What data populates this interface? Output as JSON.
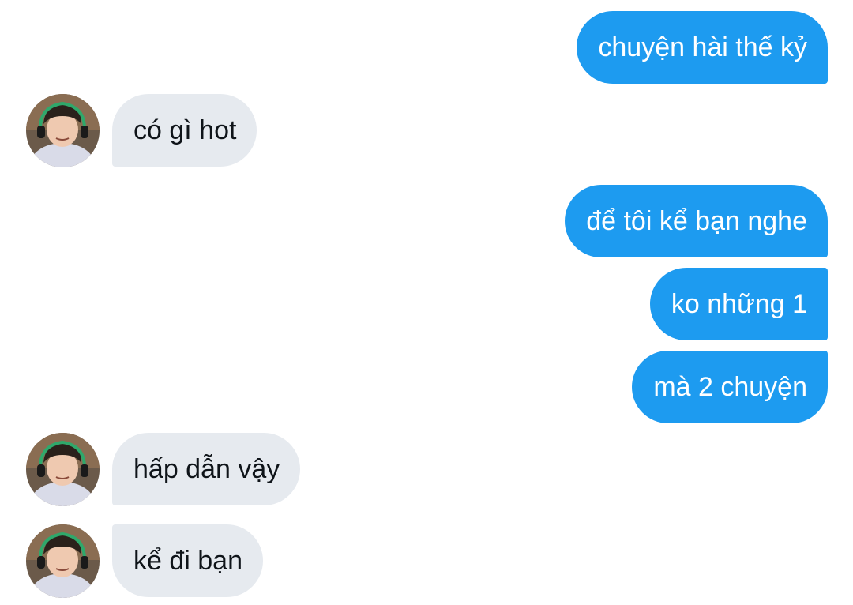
{
  "conversation": {
    "messages": [
      {
        "direction": "sent",
        "text": "chuyện hài thế kỷ"
      },
      {
        "direction": "received",
        "text": "có gì hot"
      },
      {
        "direction": "sent",
        "text": "để tôi kể bạn nghe"
      },
      {
        "direction": "sent",
        "text": "ko những 1"
      },
      {
        "direction": "sent",
        "text": "mà 2 chuyện"
      },
      {
        "direction": "received",
        "text": "hấp dẫn vậy"
      },
      {
        "direction": "received",
        "text": "kể đi bạn"
      }
    ],
    "avatar_icon": "user-avatar-photo",
    "colors": {
      "sent_bubble": "#1d9bf0",
      "sent_text": "#ffffff",
      "received_bubble": "#e6eaef",
      "received_text": "#0f1419",
      "background": "#ffffff"
    }
  }
}
